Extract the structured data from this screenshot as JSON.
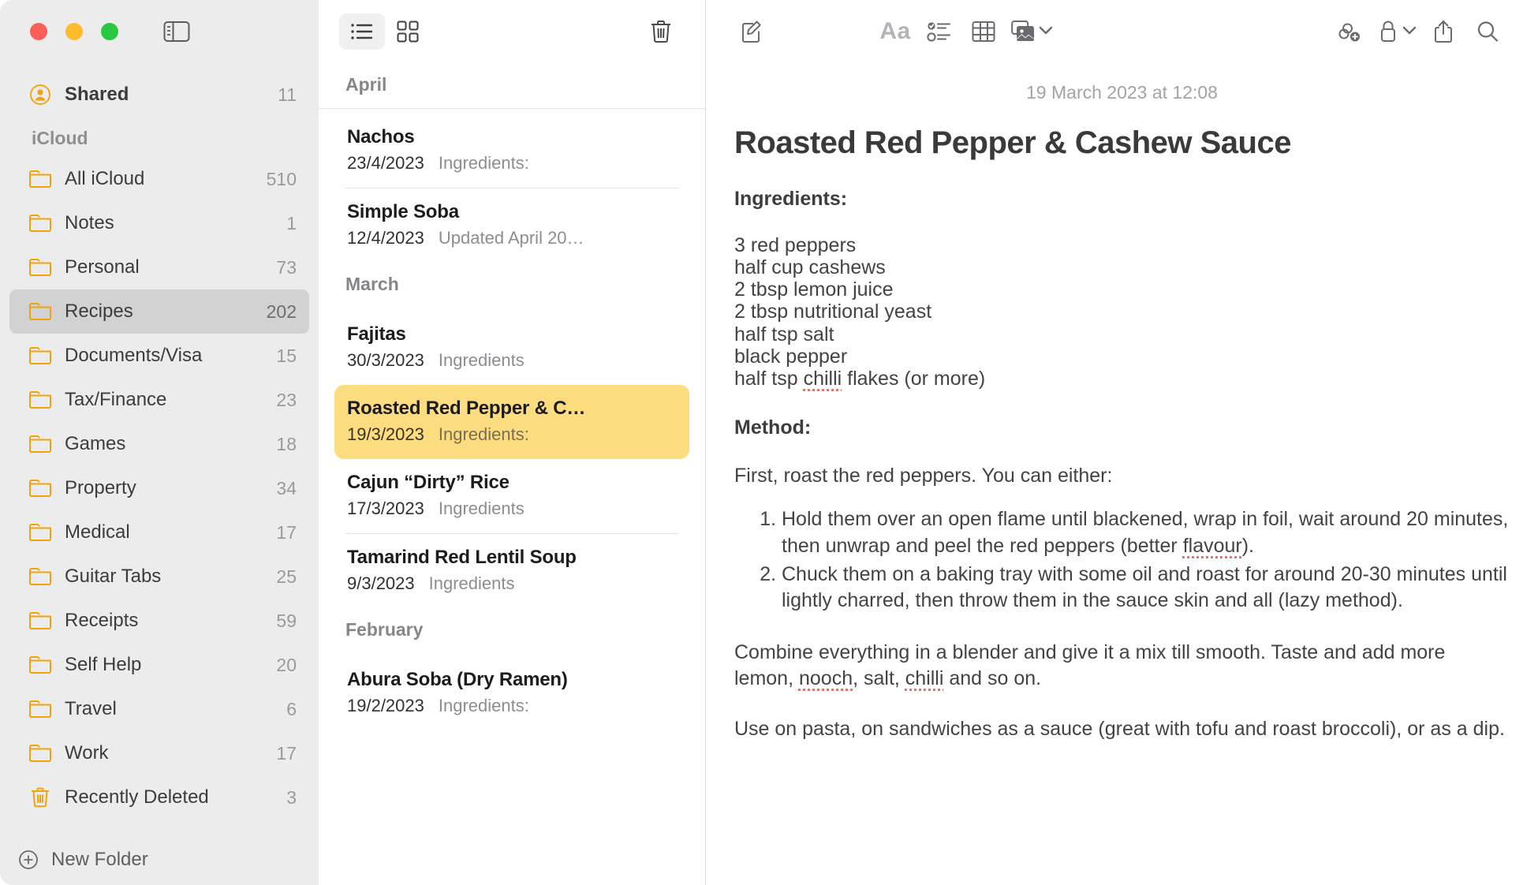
{
  "window": {
    "traffic_lights": [
      "close",
      "minimize",
      "zoom"
    ],
    "colors": {
      "accent_folder": "#f0a30a",
      "selected_note": "#fbdc7f",
      "sidebar_bg": "#ececec",
      "spellcheck": "#fb6a5e"
    }
  },
  "sidebar": {
    "toggle_icon": "sidebar-toggle-icon",
    "shared": {
      "label": "Shared",
      "count": "11",
      "icon": "shared-person-icon"
    },
    "section_label": "iCloud",
    "folders": [
      {
        "label": "All iCloud",
        "count": "510",
        "icon": "folder-icon",
        "selected": false
      },
      {
        "label": "Notes",
        "count": "1",
        "icon": "folder-icon",
        "selected": false
      },
      {
        "label": "Personal",
        "count": "73",
        "icon": "folder-icon",
        "selected": false
      },
      {
        "label": "Recipes",
        "count": "202",
        "icon": "folder-icon",
        "selected": true
      },
      {
        "label": "Documents/Visa",
        "count": "15",
        "icon": "folder-icon",
        "selected": false
      },
      {
        "label": "Tax/Finance",
        "count": "23",
        "icon": "folder-icon",
        "selected": false
      },
      {
        "label": "Games",
        "count": "18",
        "icon": "folder-icon",
        "selected": false
      },
      {
        "label": "Property",
        "count": "34",
        "icon": "folder-icon",
        "selected": false
      },
      {
        "label": "Medical",
        "count": "17",
        "icon": "folder-icon",
        "selected": false
      },
      {
        "label": "Guitar Tabs",
        "count": "25",
        "icon": "folder-icon",
        "selected": false
      },
      {
        "label": "Receipts",
        "count": "59",
        "icon": "folder-icon",
        "selected": false
      },
      {
        "label": "Self Help",
        "count": "20",
        "icon": "folder-icon",
        "selected": false
      },
      {
        "label": "Travel",
        "count": "6",
        "icon": "folder-icon",
        "selected": false
      },
      {
        "label": "Work",
        "count": "17",
        "icon": "folder-icon",
        "selected": false
      },
      {
        "label": "Recently Deleted",
        "count": "3",
        "icon": "trash-icon",
        "selected": false
      }
    ],
    "new_folder": {
      "label": "New Folder",
      "icon": "plus-circle-icon"
    }
  },
  "notes_list": {
    "toolbar": {
      "list_view": {
        "icon": "list-view-icon",
        "active": true
      },
      "gallery_view": {
        "icon": "gallery-view-icon",
        "active": false
      },
      "delete": {
        "icon": "trash-icon"
      }
    },
    "groups": [
      {
        "month": "April",
        "notes": [
          {
            "title": "Nachos",
            "date": "23/4/2023",
            "snippet": "Ingredients:",
            "selected": false
          },
          {
            "title": "Simple Soba",
            "date": "12/4/2023",
            "snippet": "Updated April 20…",
            "selected": false
          }
        ]
      },
      {
        "month": "March",
        "notes": [
          {
            "title": "Fajitas",
            "date": "30/3/2023",
            "snippet": "Ingredients",
            "selected": false
          },
          {
            "title": "Roasted Red Pepper & C…",
            "date": "19/3/2023",
            "snippet": "Ingredients:",
            "selected": true
          },
          {
            "title": "Cajun “Dirty” Rice",
            "date": "17/3/2023",
            "snippet": "Ingredients",
            "selected": false
          },
          {
            "title": "Tamarind Red Lentil Soup",
            "date": "9/3/2023",
            "snippet": "Ingredients",
            "selected": false
          }
        ]
      },
      {
        "month": "February",
        "notes": [
          {
            "title": "Abura Soba (Dry Ramen)",
            "date": "19/2/2023",
            "snippet": "Ingredients:",
            "selected": false
          }
        ]
      }
    ]
  },
  "editor": {
    "toolbar": {
      "compose": {
        "label": "Compose",
        "icon": "compose-icon"
      },
      "format": {
        "label": "Aa",
        "icon": "text-format-icon",
        "dimmed": true
      },
      "checklist": {
        "label": "Checklist",
        "icon": "checklist-icon"
      },
      "table": {
        "label": "Table",
        "icon": "table-icon"
      },
      "media": {
        "label": "Media",
        "icon": "media-image-icon",
        "chevron": "chevron-down-icon"
      },
      "collaborate": {
        "label": "Collaborate",
        "icon": "add-people-link-icon"
      },
      "lock": {
        "label": "Lock",
        "icon": "lock-icon",
        "chevron": "chevron-down-icon"
      },
      "share": {
        "label": "Share",
        "icon": "share-icon"
      },
      "search": {
        "label": "Search",
        "icon": "search-icon"
      }
    },
    "date": "19 March 2023 at 12:08",
    "title": "Roasted Red Pepper & Cashew Sauce",
    "ingredients_heading": "Ingredients:",
    "ingredients": [
      "3 red peppers",
      "half cup cashews",
      "2 tbsp lemon juice",
      "2 tbsp nutritional yeast",
      "half tsp salt",
      "black pepper"
    ],
    "ingredient_last_pre": "half tsp ",
    "ingredient_last_misspelled": "chilli",
    "ingredient_last_post": " flakes (or more)",
    "method_heading": "Method:",
    "method_intro": "First, roast the red peppers. You can either:",
    "step1_a": "Hold them over an open flame until blackened, wrap in foil, wait around 20 minutes, then unwrap and peel the red peppers (better ",
    "step1_misspelled": "flavour",
    "step1_b": ").",
    "step2": "Chuck them on a baking tray with some oil and roast for around 20-30 minutes until lightly charred, then throw them in the sauce skin and all (lazy method).",
    "para1_a": "Combine everything in a blender and give it a mix till smooth. Taste and add more lemon, ",
    "para1_misspelled_1": "nooch",
    "para1_b": ", salt, ",
    "para1_misspelled_2": "chilli",
    "para1_c": " and so on.",
    "para2": "Use on pasta, on sandwiches as a sauce (great with tofu and roast broccoli), or as a dip."
  }
}
